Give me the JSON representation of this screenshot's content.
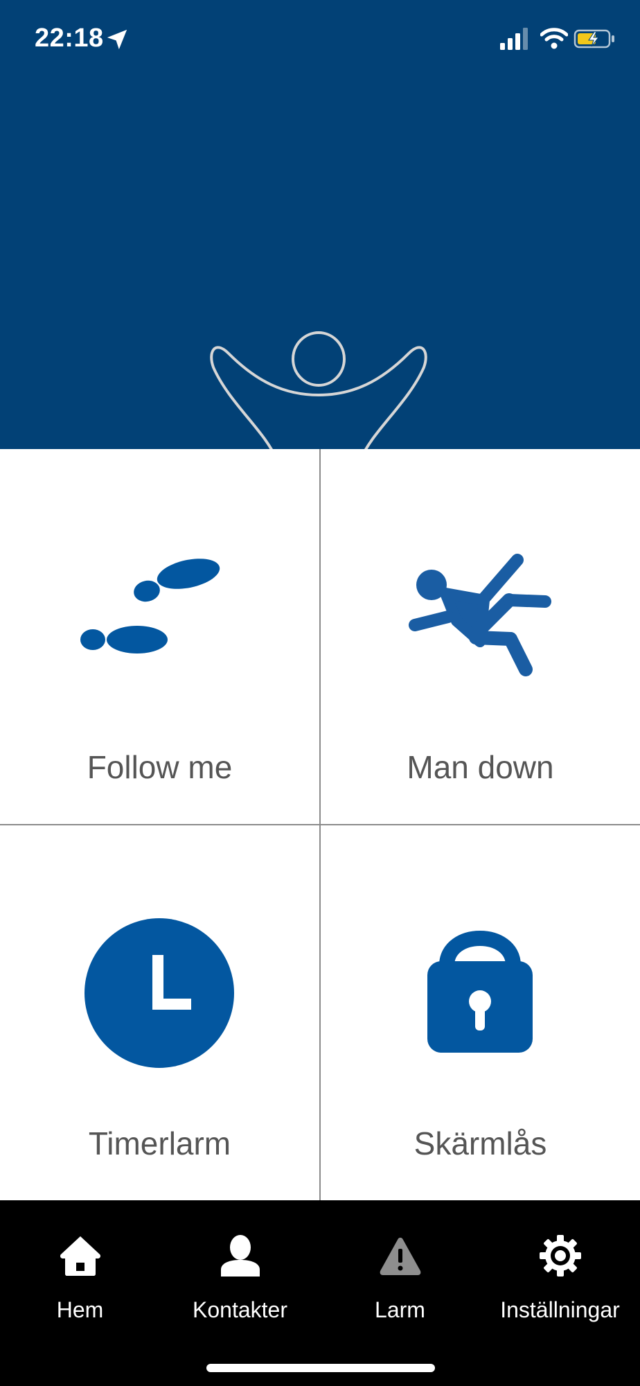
{
  "status_bar": {
    "time": "22:18"
  },
  "tiles": [
    {
      "label": "Follow me",
      "icon": "footsteps-icon"
    },
    {
      "label": "Man down",
      "icon": "falling-person-icon"
    },
    {
      "label": "Timerlarm",
      "icon": "clock-icon"
    },
    {
      "label": "Skärmlås",
      "icon": "padlock-icon"
    }
  ],
  "tabbar": {
    "items": [
      {
        "label": "Hem",
        "icon": "home-icon"
      },
      {
        "label": "Kontakter",
        "icon": "person-icon"
      },
      {
        "label": "Larm",
        "icon": "warning-icon"
      },
      {
        "label": "Inställningar",
        "icon": "gear-icon"
      }
    ]
  },
  "colors": {
    "header": "#024176",
    "accent": "#0357a0",
    "tab_background": "#000000",
    "label_text": "#555555",
    "battery": "#f2c81b"
  }
}
